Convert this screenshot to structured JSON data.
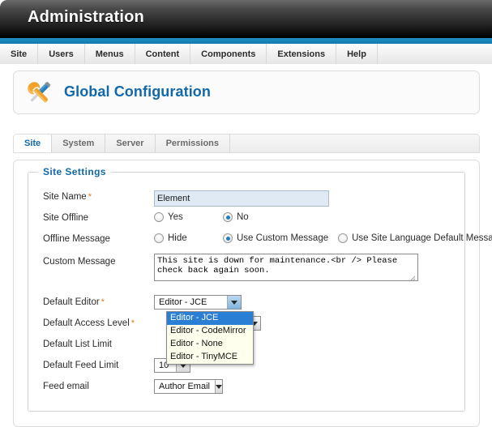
{
  "titlebar": {
    "title": "Administration"
  },
  "menubar": {
    "items": [
      {
        "label": "Site"
      },
      {
        "label": "Users"
      },
      {
        "label": "Menus"
      },
      {
        "label": "Content"
      },
      {
        "label": "Components"
      },
      {
        "label": "Extensions"
      },
      {
        "label": "Help"
      }
    ]
  },
  "header": {
    "title": "Global Configuration",
    "icon": "tools-wrench-screwdriver-icon"
  },
  "tabs": {
    "items": [
      {
        "label": "Site",
        "active": true
      },
      {
        "label": "System",
        "active": false
      },
      {
        "label": "Server",
        "active": false
      },
      {
        "label": "Permissions",
        "active": false
      }
    ]
  },
  "fieldset": {
    "legend": "Site Settings"
  },
  "form": {
    "site_name": {
      "label": "Site Name",
      "required": "*",
      "value": "Element",
      "placeholder": ""
    },
    "site_offline": {
      "label": "Site Offline",
      "options": [
        {
          "label": "Yes",
          "checked": false
        },
        {
          "label": "No",
          "checked": true
        }
      ]
    },
    "offline_message": {
      "label": "Offline Message",
      "options": [
        {
          "label": "Hide",
          "checked": false
        },
        {
          "label": "Use Custom Message",
          "checked": true
        },
        {
          "label": "Use Site Language Default Message",
          "checked": false
        }
      ]
    },
    "custom_message": {
      "label": "Custom Message",
      "value": "This site is down for maintenance.<br /> Please check back again soon."
    },
    "default_editor": {
      "label": "Default Editor",
      "required": "*",
      "value": "Editor - JCE",
      "open": true,
      "options": [
        {
          "label": "Editor - JCE",
          "selected": true
        },
        {
          "label": "Editor - CodeMirror",
          "selected": false
        },
        {
          "label": "Editor - None",
          "selected": false
        },
        {
          "label": "Editor - TinyMCE",
          "selected": false
        }
      ]
    },
    "default_access_level": {
      "label": "Default Access Level",
      "required": "*"
    },
    "default_list_limit": {
      "label": "Default List Limit"
    },
    "default_feed_limit": {
      "label": "Default Feed Limit",
      "value": "10"
    },
    "feed_email": {
      "label": "Feed email",
      "value": "Author Email"
    }
  },
  "colors": {
    "accent_blue": "#1179ab",
    "title_blue": "#1268a8",
    "required_orange": "#e07a1f",
    "highlight_blue": "#2a7fd4",
    "dropdown_bg": "#ffffed",
    "input_bg": "#dfeaf5"
  }
}
